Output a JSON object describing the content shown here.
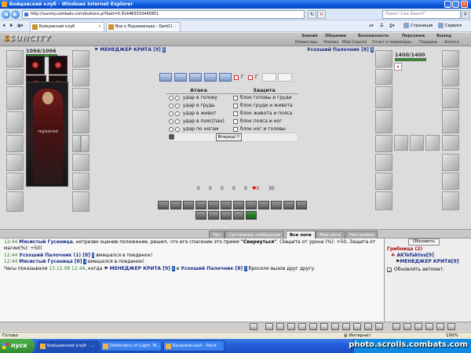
{
  "window": {
    "title": "Бойцовский клуб - Windows Internet Explorer"
  },
  "address": {
    "url": "http://sunoty.combats.com/buttons.pl?batt=0.914483333445851",
    "search_placeholder": "Поиск \"Live Search\""
  },
  "tabs": [
    {
      "label": "Бойцовский клуб"
    },
    {
      "label": "Все о Подземельях - DarkCl..."
    }
  ],
  "ie_toolbar": {
    "page": "Страница",
    "service": "Сервис"
  },
  "game": {
    "logo_prefix": "S",
    "logo": "SUNCITY",
    "menu": [
      "Знания",
      "Общение",
      "Безопасность",
      "Персонаж",
      "Выход"
    ],
    "submenu": [
      "Инвентарь",
      "Умения",
      "Мой Скролл",
      "Отчет о переводах",
      "Подарки",
      "Анкета"
    ]
  },
  "player_left": {
    "hp": "1096/1096",
    "name": "МЕНЕДЖЕР КРИТА [9]",
    "watermark": "registered"
  },
  "player_right": {
    "hp": "1400/1400",
    "name": "Усохший Палочник [8]"
  },
  "combat": {
    "attack_title": "Атака",
    "defense_title": "Защита",
    "attacks": [
      "удар в голову",
      "удар в грудь",
      "удар в живот",
      "удар в пояс(пах)",
      "удар по ногам"
    ],
    "defenses": [
      "блок головы и груди",
      "блок груди и живота",
      "блок живота и пояса",
      "блок пояса и ног",
      "блок ног и головы"
    ],
    "go_button": "Вперед!!!",
    "icon_marks": [
      "Г",
      "Г"
    ]
  },
  "stats": [
    "0",
    "0",
    "0",
    "0",
    "0",
    "♥0",
    "30"
  ],
  "lower_tabs": [
    "Чат",
    "Системные сообщения",
    "Все логи",
    "Мои логи",
    "Настройки"
  ],
  "chat": [
    {
      "time": "12:44",
      "user": "Мясистый Гусеница",
      "text": ", нетрезво оценив положение, решил, что его спасение это прием ",
      "bold": "\"Свернуться\"",
      "rest": ". (Защита от урона (%): +50, Защита от"
    },
    {
      "time": "",
      "user": "",
      "text": "магии(%): +50)",
      "bold": "",
      "rest": ""
    },
    {
      "time": "12:44",
      "user": "Усохший Палочник (1) [8]",
      "text": " вмешался в поединок!",
      "bold": "",
      "rest": ""
    },
    {
      "time": "12:44",
      "user": "Мясистый Гусеница [8]",
      "text": " вмешался в поединок!",
      "bold": "",
      "rest": ""
    },
    {
      "time": "",
      "user": "",
      "text": "Часы показывали ",
      "bold": "",
      "rest": ""
    }
  ],
  "chat_last": {
    "prefix": "Часы показывали ",
    "date": "13.12.08 12:44",
    "mid": ", когда ",
    "u1": "МЕНЕДЖЕР КРИТА [9]",
    "and": " и ",
    "u2": "Усохший Палочник [8]",
    "end": " бросили вызов друг другу."
  },
  "right_panel": {
    "refresh": "Обновить",
    "location": "Грибница (2)",
    "user": "AKTefaktos[9]",
    "user2": "МЕНЕДЖЕР КРИТА[9]",
    "auto": "Обновлять автомат."
  },
  "statusbar": {
    "left": "Готово",
    "zone": "Интернет",
    "zoom": "100%"
  },
  "taskbar": {
    "start": "пуск",
    "tasks": [
      "Бойцовский клуб - ...",
      "Defenders of Light: M...",
      "Безымянный - Paint"
    ],
    "watermark": "photo.scrolls.combats.com"
  }
}
